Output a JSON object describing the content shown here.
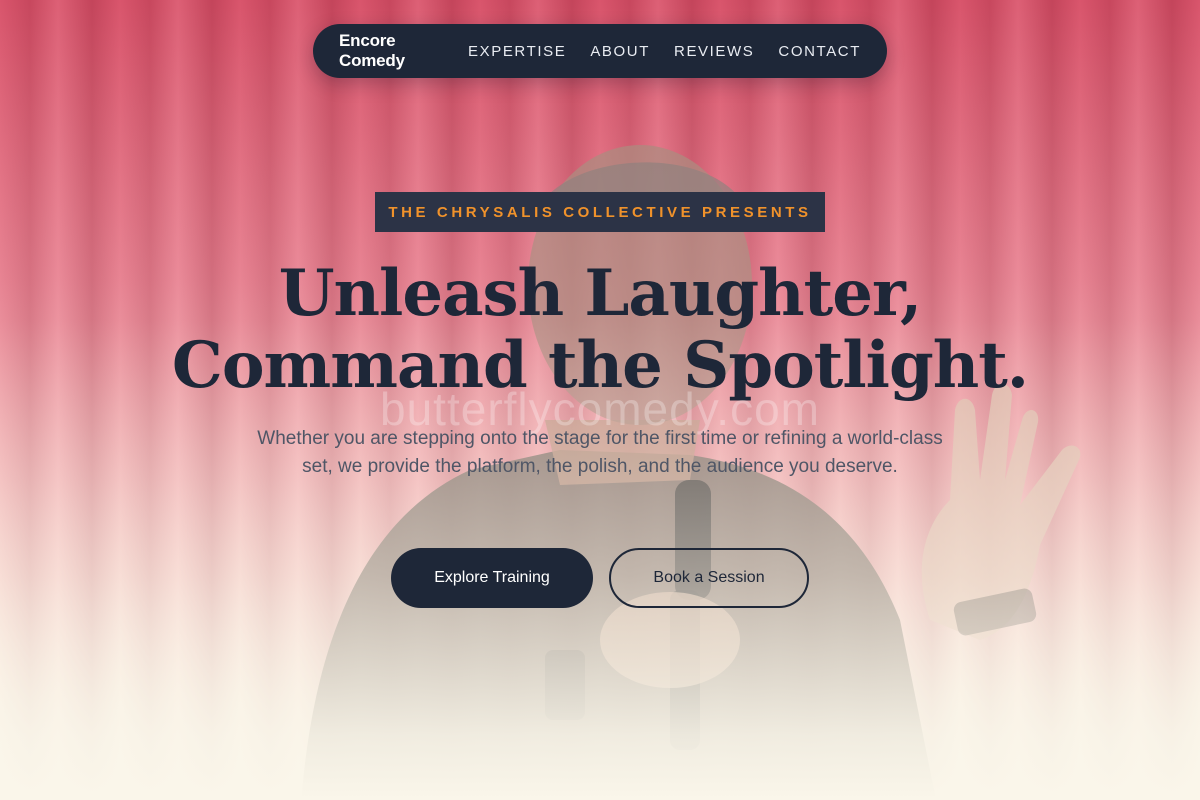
{
  "nav": {
    "brand": "Encore Comedy",
    "links": [
      "EXPERTISE",
      "ABOUT",
      "REVIEWS",
      "CONTACT"
    ]
  },
  "hero": {
    "eyebrow": "THE CHRYSALIS COLLECTIVE PRESENTS",
    "headline_line1": "Unleash Laughter,",
    "headline_line2": "Command the Spotlight.",
    "watermark": "butterflycomedy.com",
    "subtext": "Whether you are stepping onto the stage for the first time or refining a world-class set, we provide the platform, the polish, and the audience you deserve.",
    "primary_cta": "Explore Training",
    "secondary_cta": "Book a Session"
  },
  "colors": {
    "navy": "#1e2738",
    "accent_orange": "#f0922b",
    "curtain_red": "#d9556c",
    "cream": "#faf6ea"
  },
  "background_image": "comedian-on-stage-with-microphone-photo"
}
